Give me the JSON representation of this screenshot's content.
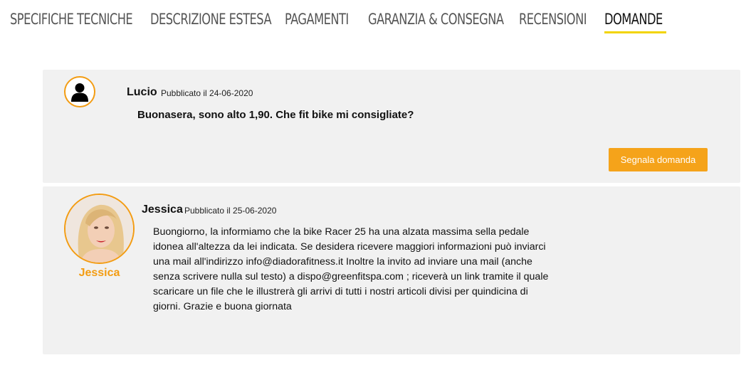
{
  "tabs": [
    {
      "label": "SPECIFICHE TECNICHE",
      "active": false
    },
    {
      "label": "DESCRIZIONE ESTESA",
      "active": false
    },
    {
      "label": "PAGAMENTI",
      "active": false
    },
    {
      "label": "GARANZIA & CONSEGNA",
      "active": false
    },
    {
      "label": "RECENSIONI",
      "active": false
    },
    {
      "label": "DOMANDE",
      "active": true
    }
  ],
  "question": {
    "author": "Lucio",
    "meta": "Pubblicato il 24-06-2020",
    "text": "Buonasera, sono alto 1,90. Che fit bike mi consigliate?",
    "report_label": "Segnala domanda",
    "avatar_icon": "user-icon"
  },
  "answer": {
    "author": "Jessica",
    "meta": "Pubblicato il 25-06-2020",
    "badge": "Jessica",
    "text": "Buongiorno, la informiamo che la bike Racer 25 ha una alzata massima sella pedale idonea all'altezza da lei indicata. Se desidera ricevere maggiori informazioni può inviarci una mail all'indirizzo info@diadorafitness.it Inoltre la invito ad inviare una mail (anche senza scrivere nulla sul testo) a dispo@greenfitspa.com ; riceverà un link tramite il quale scaricare un file che le illustrerà gli arrivi di tutti i nostri articoli divisi per quindicina di giorni. Grazie e buona giornata"
  },
  "colors": {
    "accent": "#f5a31a",
    "tab_underline": "#f2d400",
    "card_bg": "#f1f1f1"
  }
}
